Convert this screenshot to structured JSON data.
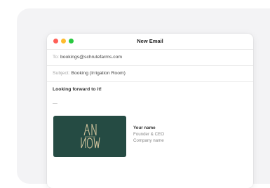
{
  "window": {
    "title": "New Email",
    "traffic_lights": {
      "close": "#ff5f57",
      "minimize": "#febc2e",
      "maximize": "#28c840"
    }
  },
  "to": {
    "label": "To:",
    "value": "bookings@schrutefarms.com"
  },
  "subject": {
    "label": "Subject:",
    "value": "Booking (Irrigation Room)"
  },
  "body": {
    "text": "Looking forward to it!",
    "separator": "—"
  },
  "signature": {
    "logo": {
      "text_top": "AN",
      "text_bottom": "NOW",
      "bg_color": "#254b43",
      "fg_color": "#d8c8a0"
    },
    "name": "Your name",
    "role": "Founder & CEO",
    "company": "Company name"
  }
}
